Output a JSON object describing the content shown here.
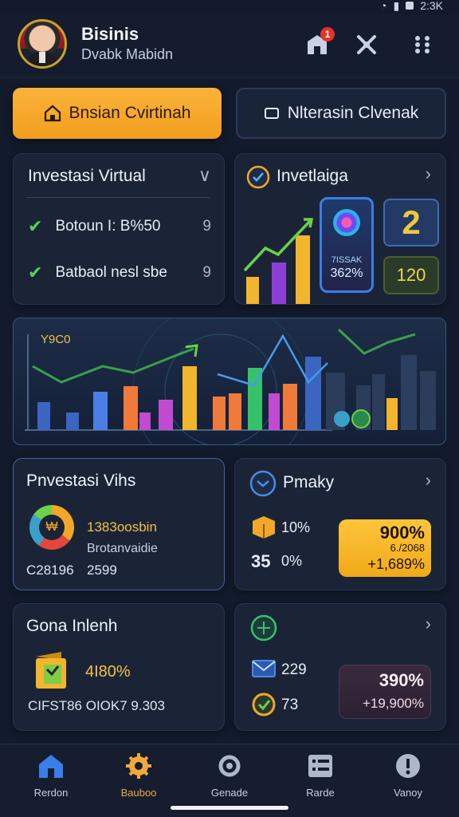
{
  "status": {
    "time": "2:3K"
  },
  "header": {
    "title": "Bisinis",
    "subtitle": "Dvabk Mabidn",
    "notification_count": "1"
  },
  "actions": {
    "primary_label": "Bnsian Cvirtinah",
    "secondary_label": "Nlterasin Clvenak"
  },
  "card_invest": {
    "title": "Investasi Virtual",
    "rows": [
      {
        "label": "Botoun I: B%50",
        "count": "9"
      },
      {
        "label": "Batbaol nesl sbe",
        "count": "9"
      }
    ]
  },
  "card_invetaiga": {
    "title": "Invetlaiga",
    "phone_line1": "7ISSAK",
    "phone_line2": "362%",
    "badge_number": "2",
    "badge_value": "120"
  },
  "hero_chart": {
    "label": "Y9C0"
  },
  "card_pnvestasi": {
    "title": "Pnvestasi Vihs",
    "value_main": "1383oosbin",
    "value_sub": "Brotanvaidie",
    "foot_left": "C28196",
    "foot_right": "2599"
  },
  "card_pmaky": {
    "title": "Pmaky",
    "row1": "10%",
    "row2_num": "35",
    "row2_pct": "0%",
    "box_top": "900%",
    "box_mid": "6./2068",
    "box_bottom": "+1,689%"
  },
  "card_gona": {
    "title": "Gona Inlenh",
    "value": "4I80%",
    "foot": "CIFST86 OIOK7 9.303"
  },
  "card_bottom_right": {
    "row1": "229",
    "row2": "73",
    "box_top": "390%",
    "box_bottom": "+19,900%"
  },
  "nav": [
    {
      "label": "Rerdon"
    },
    {
      "label": "Bauboo"
    },
    {
      "label": "Genade"
    },
    {
      "label": "Rarde"
    },
    {
      "label": "Vanoy"
    }
  ]
}
